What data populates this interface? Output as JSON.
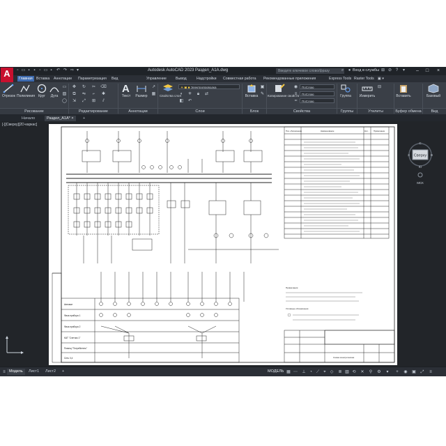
{
  "app": {
    "logo_letter": "A",
    "title": "Autodesk AutoCAD 2023   Раздел_А1А.dwg",
    "search_placeholder": "Введите ключевое слово/фразу",
    "signin_label": "Вход в службы",
    "accent": "#3d6bb0",
    "logo_color": "#c8102e"
  },
  "ribbon_tabs": [
    "Главная",
    "Вставка",
    "Аннотации",
    "Параметризация",
    "Вид",
    "Управление",
    "Вывод",
    "Надстройки",
    "Совместная работа",
    "Рекомендованные приложения",
    "Express Tools",
    "Raster Tools"
  ],
  "ribbon": {
    "draw_buttons": [
      "Отрезок",
      "Полилиния",
      "Круг",
      "Дуга"
    ],
    "draw_group": "Рисование",
    "modify_group": "Редактирование",
    "text_label": "Текст",
    "dim_label": "Размер",
    "annot_group": "Аннотации",
    "layer_props_label": "Свойства слоя",
    "layer_combo": "Электропроводка",
    "layers_group": "Слои",
    "insert_label": "Вставка",
    "block_group": "Блок",
    "copy_props_label": "Копирование свойств",
    "color_combo": "ПоСлою",
    "linetype_combo": "ПоСлою",
    "lineweight_combo": "ПоСлою",
    "properties_group": "Свойства",
    "group_label": "Группа",
    "groups_group": "Группы",
    "measure_label": "Измерить",
    "utilities_group": "Утилиты",
    "paste_label": "Вставить",
    "clipboard_group": "Буфер обмена",
    "base_label": "Базовый",
    "view_group": "Вид"
  },
  "file_tabs": [
    "Начало",
    "Раздел_А1А*"
  ],
  "viewport_label": "[-][Сверху][2D-каркас]",
  "navcube": {
    "face": "Сверху",
    "n": "С",
    "s": "Ю",
    "w": "З",
    "e": "В",
    "wcs": "МСК"
  },
  "layout_tabs": [
    "Модель",
    "Лист1",
    "Лист2"
  ],
  "status": {
    "model": "МОДЕЛЬ"
  },
  "drawing": {
    "spec_header": [
      "Поз. обозначение",
      "Наименование",
      "Кол.",
      "Примечание"
    ],
    "row_labels": [
      "Автомат",
      "Фаза прибора 1",
      "Фаза прибора 2",
      "КАТ \"Счетчик 1\"",
      "Помещ \"Потребитель\"",
      "Сеть 0,4"
    ],
    "notes_title": "Примечания",
    "legend_title": "Условные обозначения",
    "stamp_text": "Схема электрическая"
  }
}
